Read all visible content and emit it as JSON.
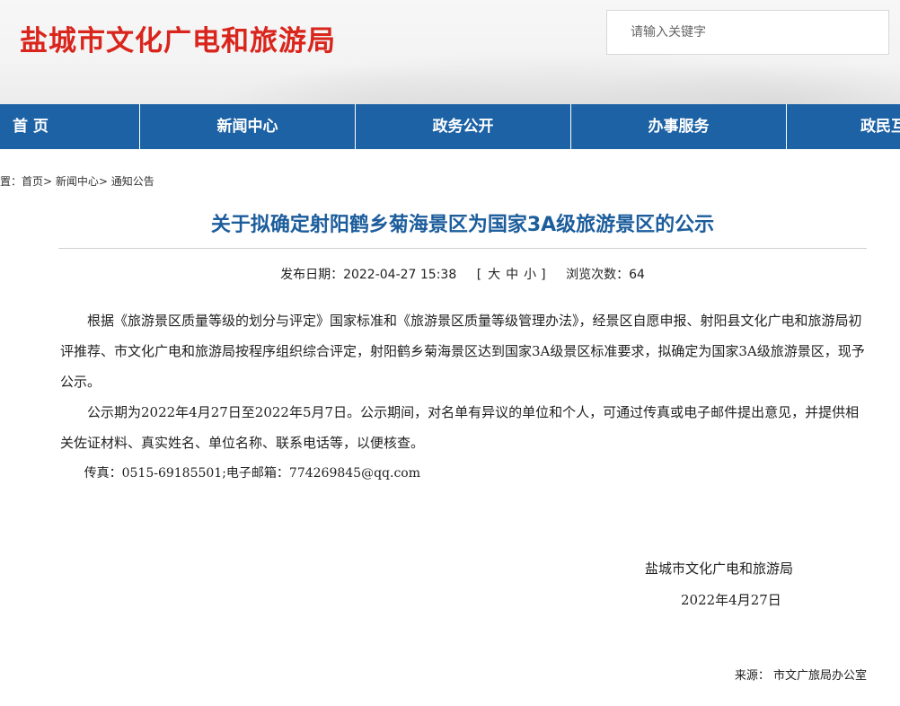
{
  "header": {
    "site_title": "盐城市文化广电和旅游局",
    "search_placeholder": "请输入关键字"
  },
  "nav": {
    "items": [
      "首 页",
      "新闻中心",
      "政务公开",
      "办事服务",
      "政民互动"
    ]
  },
  "breadcrumb": {
    "prefix": "位置：",
    "home": "首页",
    "sep": "> ",
    "section": "新闻中心",
    "current": "通知公告"
  },
  "article": {
    "title": "关于拟确定射阳鹤乡菊海景区为国家3A级旅游景区的公示",
    "publish_label": "发布日期：",
    "publish_date": "2022-04-27 15:38",
    "font_open": "[",
    "font_large": "大",
    "font_medium": "中",
    "font_small": "小",
    "font_close": "]",
    "views_label": "浏览次数：",
    "views": "64",
    "paragraphs": [
      "根据《旅游景区质量等级的划分与评定》国家标准和《旅游景区质量等级管理办法》，经景区自愿申报、射阳县文化广电和旅游局初评推荐、市文化广电和旅游局按程序组织综合评定，射阳鹤乡菊海景区达到国家3A级景区标准要求，拟确定为国家3A级旅游景区，现予公示。",
      "公示期为2022年4月27日至2022年5月7日。公示期间，对名单有异议的单位和个人，可通过传真或电子邮件提出意见，并提供相关佐证材料、真实姓名、单位名称、联系电话等，以便核查。"
    ],
    "contact": "传真：0515-69185501;电子邮箱：774269845@qq.com",
    "sign_org": "盐城市文化广电和旅游局",
    "sign_date": "2022年4月27日",
    "source": "来源：  市文广旅局办公室"
  }
}
